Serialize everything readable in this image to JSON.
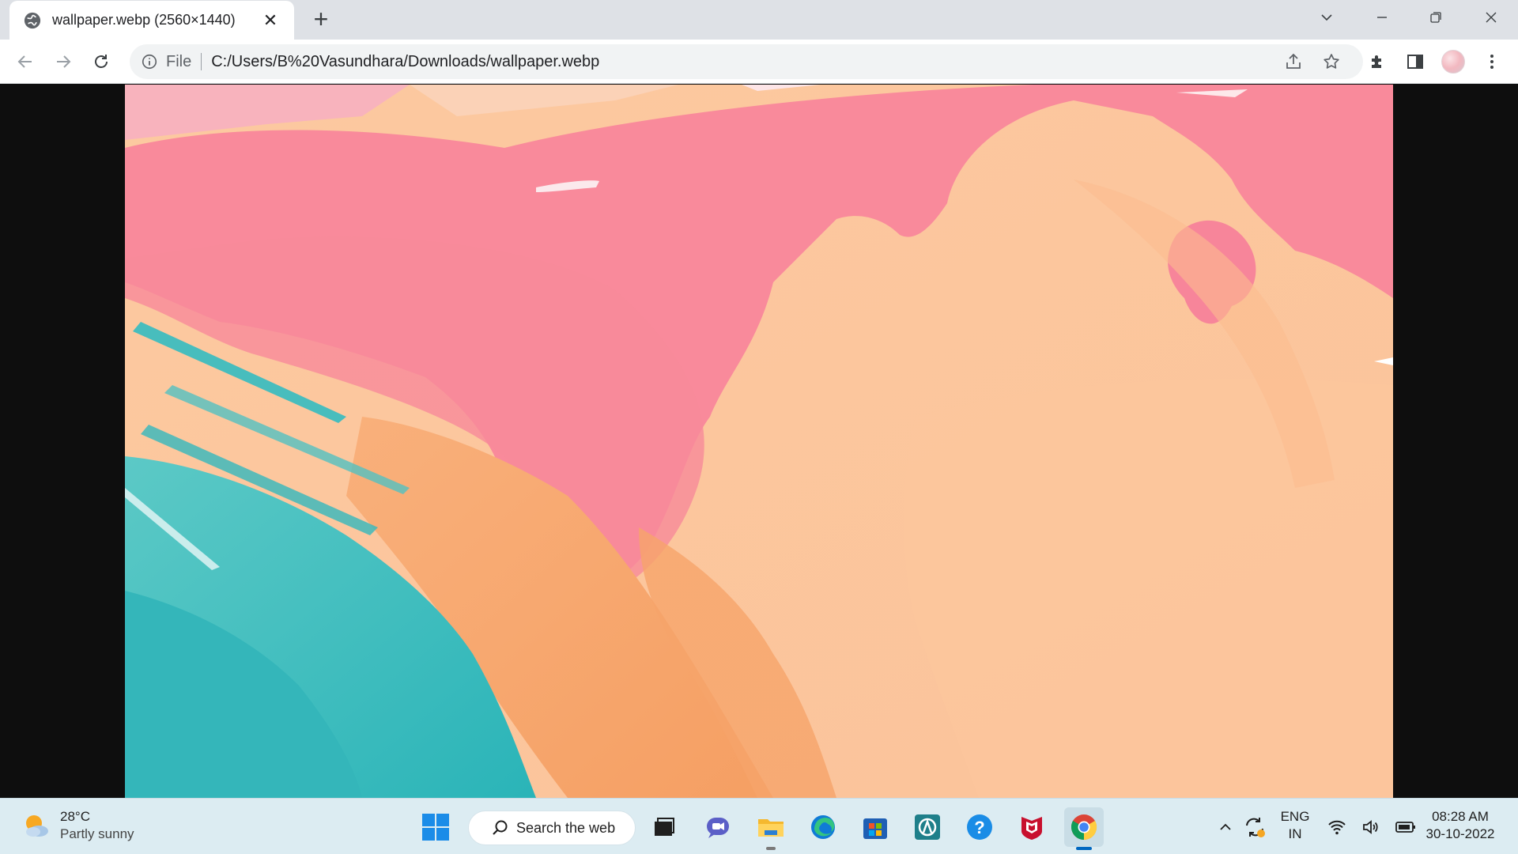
{
  "browser": {
    "tab": {
      "title": "wallpaper.webp (2560×1440)"
    },
    "omnibox": {
      "scheme_label": "File",
      "url": "C:/Users/B%20Vasundhara/Downloads/wallpaper.webp"
    }
  },
  "image": {
    "file_name": "wallpaper.webp",
    "natural_width": 2560,
    "natural_height": 1440,
    "palette": {
      "pink": "#f98a9b",
      "peach": "#f9c193",
      "orange": "#f7a96a",
      "teal": "#2fb9bd",
      "white": "#fbe9ec"
    }
  },
  "taskbar": {
    "weather": {
      "temp": "28°C",
      "condition": "Partly sunny"
    },
    "search_label": "Search the web",
    "tray": {
      "lang_line1": "ENG",
      "lang_line2": "IN",
      "time": "08:28 AM",
      "date": "30-10-2022"
    },
    "pinned_apps": [
      "start",
      "search",
      "task-view",
      "teams-chat",
      "file-explorer",
      "edge",
      "microsoft-store",
      "app",
      "help",
      "mcafee",
      "chrome"
    ],
    "active_app": "chrome"
  },
  "colors": {
    "tabstrip": "#dee1e6",
    "toolbar": "#ffffff",
    "omnibox": "#f1f3f4",
    "viewer_bg": "#0e0e0e",
    "taskbar": "#dcecf2",
    "accent": "#0067c0"
  }
}
